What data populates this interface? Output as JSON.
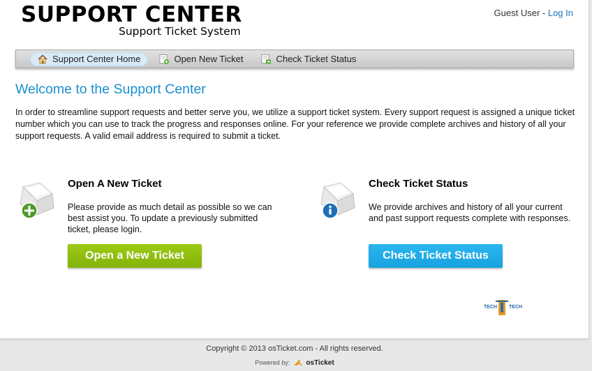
{
  "header": {
    "logo_title": "SUPPORT CENTER",
    "logo_subtitle": "Support Ticket System",
    "user_label": "Guest User",
    "separator": " - ",
    "login_link": "Log In"
  },
  "nav": {
    "items": [
      {
        "label": "Support Center Home",
        "icon": "home-icon",
        "active": true
      },
      {
        "label": "Open New Ticket",
        "icon": "new-ticket-icon",
        "active": false
      },
      {
        "label": "Check Ticket Status",
        "icon": "ticket-status-icon",
        "active": false
      }
    ]
  },
  "main": {
    "title": "Welcome to the Support Center",
    "intro": "In order to streamline support requests and better serve you, we utilize a support ticket system. Every support request is assigned a unique ticket number which you can use to track the progress and responses online. For your reference we provide complete archives and history of all your support requests. A valid email address is required to submit a ticket.",
    "open_card": {
      "heading": "Open A New Ticket",
      "text": "Please provide as much detail as possible so we can best assist you. To update a previously submitted ticket, please login.",
      "button": "Open a New Ticket",
      "icon": "new-ticket-large-icon"
    },
    "check_card": {
      "heading": "Check Ticket Status",
      "text": "We provide archives and history of all your current and past support requests complete with responses.",
      "button": "Check Ticket Status",
      "icon": "info-ticket-large-icon"
    },
    "sponsor_logo": "TECH TECH"
  },
  "footer": {
    "copyright": "Copyright © 2013 osTicket.com - All rights reserved.",
    "powered_by": "Powered by:",
    "brand": "osTicket"
  },
  "colors": {
    "accent_blue": "#1b8fcf",
    "link_blue": "#1b75bb",
    "green_button": "#8fbf10",
    "blue_button": "#1fa9e8"
  }
}
